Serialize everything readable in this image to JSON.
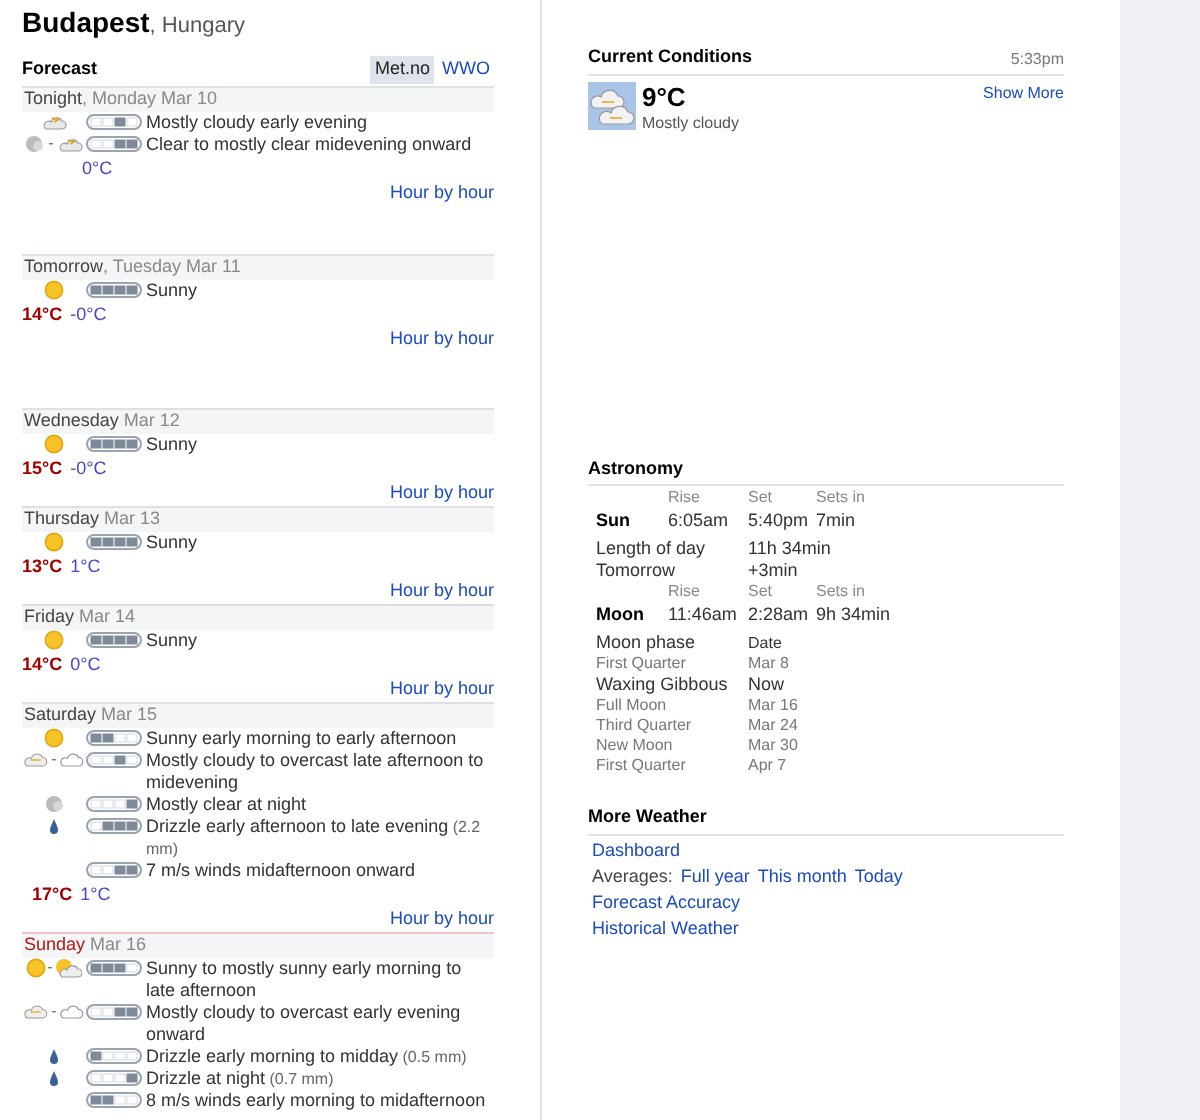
{
  "location": {
    "city": "Budapest",
    "country": ", Hungary"
  },
  "forecast": {
    "title": "Forecast",
    "sources": [
      {
        "label": "Met.no",
        "selected": true
      },
      {
        "label": "WWO",
        "selected": false
      }
    ],
    "days": [
      {
        "day": "Tonight",
        "date": ", Monday Mar 10",
        "weekend": false,
        "lines": [
          {
            "icons": [
              {
                "kind": "cloudy-night"
              }
            ],
            "segments": [
              false,
              false,
              true,
              false
            ],
            "text": "Mostly cloudy early evening"
          },
          {
            "icons": [
              {
                "kind": "clear-night"
              },
              {
                "kind": "separator",
                "text": "-"
              },
              {
                "kind": "cloudy-night"
              }
            ],
            "segments": [
              false,
              false,
              true,
              true
            ],
            "text": "Clear to mostly clear midevening onward"
          }
        ],
        "low": "0°C",
        "link": "Hour by hour"
      },
      {
        "day": "Tomorrow",
        "date": ", Tuesday Mar 11",
        "weekend": false,
        "lines": [
          {
            "icons": [
              {
                "kind": "sun"
              }
            ],
            "segments": [
              true,
              true,
              true,
              true
            ],
            "text": "Sunny"
          }
        ],
        "high": "14°C",
        "low": "-0°C",
        "link": "Hour by hour"
      },
      {
        "day": "Wednesday",
        "date": " Mar 12",
        "weekend": false,
        "lines": [
          {
            "icons": [
              {
                "kind": "sun"
              }
            ],
            "segments": [
              true,
              true,
              true,
              true
            ],
            "text": "Sunny"
          }
        ],
        "high": "15°C",
        "low": "-0°C",
        "link": "Hour by hour"
      },
      {
        "day": "Thursday",
        "date": " Mar 13",
        "weekend": false,
        "lines": [
          {
            "icons": [
              {
                "kind": "sun"
              }
            ],
            "segments": [
              true,
              true,
              true,
              true
            ],
            "text": "Sunny"
          }
        ],
        "high": "13°C",
        "low": "1°C",
        "link": "Hour by hour"
      },
      {
        "day": "Friday",
        "date": " Mar 14",
        "weekend": false,
        "lines": [
          {
            "icons": [
              {
                "kind": "sun"
              }
            ],
            "segments": [
              true,
              true,
              true,
              true
            ],
            "text": "Sunny"
          }
        ],
        "high": "14°C",
        "low": "0°C",
        "link": "Hour by hour"
      },
      {
        "day": "Saturday",
        "date": " Mar 15",
        "weekend": false,
        "lines": [
          {
            "icons": [
              {
                "kind": "sun"
              }
            ],
            "segments": [
              true,
              true,
              false,
              false
            ],
            "text": "Sunny early morning to early afternoon"
          },
          {
            "icons": [
              {
                "kind": "cloudy"
              },
              {
                "kind": "separator",
                "text": "-"
              },
              {
                "kind": "overcast"
              }
            ],
            "segments": [
              false,
              false,
              true,
              false
            ],
            "text": "Mostly cloudy to overcast late afternoon to midevening"
          },
          {
            "icons": [
              {
                "kind": "clear-night"
              }
            ],
            "segments": [
              false,
              false,
              false,
              true
            ],
            "text": "Mostly clear at night"
          },
          {
            "icons": [
              {
                "kind": "drop"
              }
            ],
            "segments": [
              false,
              true,
              true,
              true
            ],
            "text": "Drizzle early afternoon to late evening",
            "note": "(2.2 mm)"
          },
          {
            "segments": [
              false,
              false,
              true,
              true
            ],
            "text": "7 m/s winds midafternoon onward"
          }
        ],
        "high": "17°C",
        "low": "1°C",
        "link": "Hour by hour"
      },
      {
        "day": "Sunday",
        "date": " Mar 16",
        "weekend": true,
        "lines": [
          {
            "icons": [
              {
                "kind": "sun"
              },
              {
                "kind": "separator",
                "text": "-"
              },
              {
                "kind": "sun-cloud"
              }
            ],
            "segments": [
              true,
              true,
              true,
              false
            ],
            "text": "Sunny to mostly sunny early morning to late afternoon"
          },
          {
            "icons": [
              {
                "kind": "cloudy"
              },
              {
                "kind": "separator",
                "text": "-"
              },
              {
                "kind": "overcast"
              }
            ],
            "segments": [
              false,
              false,
              true,
              true
            ],
            "text": "Mostly cloudy to overcast early evening onward"
          },
          {
            "icons": [
              {
                "kind": "drop"
              }
            ],
            "segments": [
              true,
              false,
              false,
              false
            ],
            "text": "Drizzle early morning to midday",
            "note": "(0.5 mm)"
          },
          {
            "icons": [
              {
                "kind": "drop"
              }
            ],
            "segments": [
              false,
              false,
              false,
              true
            ],
            "text": "Drizzle at night",
            "note": "(0.7 mm)"
          },
          {
            "segments": [
              true,
              true,
              false,
              false
            ],
            "text": "8 m/s winds early morning to midafternoon"
          }
        ]
      }
    ]
  },
  "current": {
    "title": "Current Conditions",
    "time": "5:33pm",
    "temperature": "9°C",
    "condition": "Mostly cloudy",
    "link": "Show More"
  },
  "astronomy": {
    "title": "Astronomy",
    "sun": {
      "headers": [
        "Rise",
        "Set",
        "Sets in"
      ],
      "label": "Sun",
      "values": [
        "6:05am",
        "5:40pm",
        "7min"
      ]
    },
    "daylight": [
      {
        "label": "Length of day",
        "value": "11h 34min"
      },
      {
        "label": "Tomorrow",
        "value": "+3min"
      }
    ],
    "moon": {
      "headers": [
        "Rise",
        "Set",
        "Sets in"
      ],
      "label": "Moon",
      "values": [
        "11:46am",
        "2:28am",
        "9h 34min"
      ]
    },
    "phases_header": {
      "label": "Moon phase",
      "value": "Date"
    },
    "phases": [
      {
        "label": "First Quarter",
        "value": "Mar 8",
        "current": false
      },
      {
        "label": "Waxing Gibbous",
        "value": "Now",
        "current": true
      },
      {
        "label": "Full Moon",
        "value": "Mar 16",
        "current": false
      },
      {
        "label": "Third Quarter",
        "value": "Mar 24",
        "current": false
      },
      {
        "label": "New Moon",
        "value": "Mar 30",
        "current": false
      },
      {
        "label": "First Quarter",
        "value": "Apr 7",
        "current": false
      }
    ]
  },
  "more_weather": {
    "title": "More Weather",
    "dashboard": "Dashboard",
    "averages_label": "Averages:",
    "averages": [
      "Full year",
      "This month",
      "Today"
    ],
    "links": [
      "Forecast Accuracy",
      "Historical Weather"
    ]
  }
}
